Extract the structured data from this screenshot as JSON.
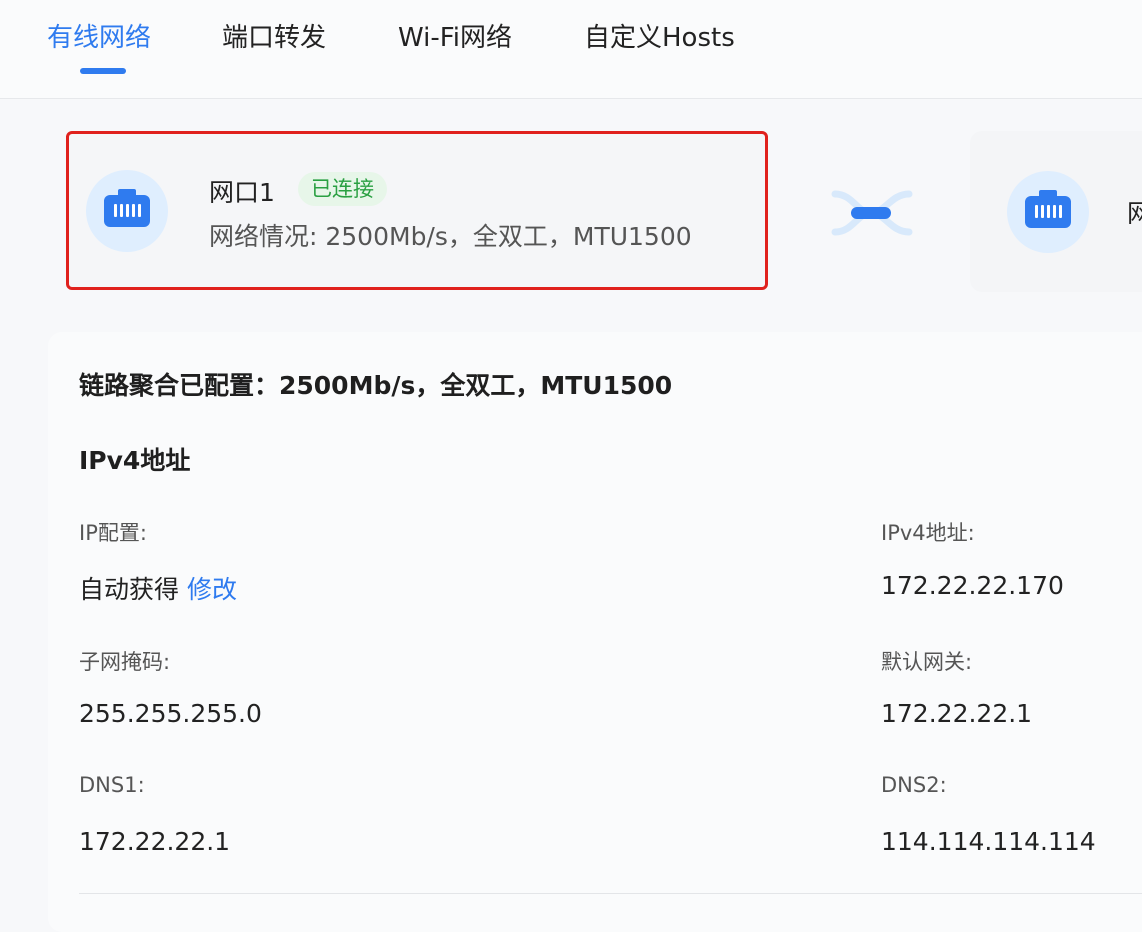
{
  "tabs": [
    {
      "label": "有线网络",
      "active": true
    },
    {
      "label": "端口转发",
      "active": false
    },
    {
      "label": "Wi-Fi网络",
      "active": false
    },
    {
      "label": "自定义Hosts",
      "active": false
    }
  ],
  "port1": {
    "icon": "ethernet-port-icon",
    "name": "网口1",
    "status_badge": "已连接",
    "status_text": "网络情况: 2500Mb/s，全双工，MTU1500"
  },
  "link_icon": "link-aggregation-icon",
  "port2": {
    "icon": "ethernet-port-icon",
    "name_partial": "网"
  },
  "details": {
    "aggregation": "链路聚合已配置：2500Mb/s，全双工，MTU1500",
    "ipv4_section_title": "IPv4地址",
    "ip_config_label": "IP配置:",
    "ip_config_value": "自动获得",
    "ip_config_edit": "修改",
    "ipv4_address_label": "IPv4地址:",
    "ipv4_address_value": "172.22.22.170",
    "subnet_label": "子网掩码:",
    "subnet_value": "255.255.255.0",
    "gateway_label": "默认网关:",
    "gateway_value": "172.22.22.1",
    "dns1_label": "DNS1:",
    "dns1_value": "172.22.22.1",
    "dns2_label": "DNS2:",
    "dns2_value": "114.114.114.114"
  },
  "colors": {
    "accent": "#2f7bef",
    "connected_green": "#2aa042",
    "highlight_red": "#e0211d",
    "icon_bg": "#dfeefe"
  }
}
